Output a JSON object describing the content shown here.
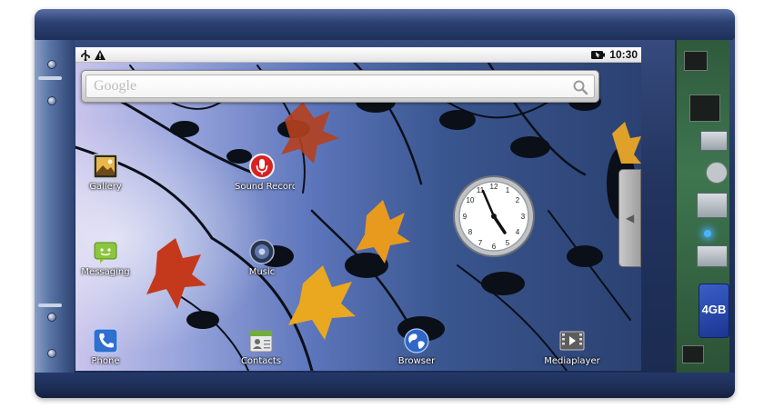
{
  "status_bar": {
    "time": "10:30",
    "left_icons": [
      "usb-icon",
      "warning-icon"
    ],
    "right_icons": [
      "battery-icon"
    ]
  },
  "search": {
    "placeholder": "Google",
    "icon": "search-icon"
  },
  "apps": [
    {
      "label": "Gallery",
      "icon": "gallery-icon"
    },
    {
      "label": "Sound Recorder",
      "icon": "microphone-icon"
    },
    {
      "label": "Messaging",
      "icon": "messaging-icon"
    },
    {
      "label": "Music",
      "icon": "speaker-icon"
    },
    {
      "label": "Phone",
      "icon": "phone-icon"
    },
    {
      "label": "Contacts",
      "icon": "contacts-icon"
    },
    {
      "label": "Browser",
      "icon": "globe-icon"
    },
    {
      "label": "Mediaplayer",
      "icon": "film-icon"
    }
  ],
  "hardware": {
    "sd_card_label": "4GB"
  },
  "colors": {
    "frame": "#22345f",
    "wallpaper_light": "#c9c4ec",
    "wallpaper_dark": "#2b4172",
    "board": "#3e7650",
    "led": "#4ab3ff"
  }
}
